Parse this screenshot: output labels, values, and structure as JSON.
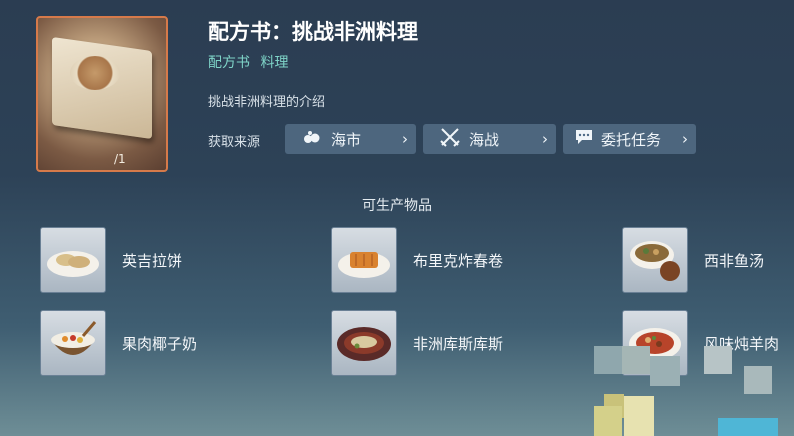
{
  "recipe": {
    "title": "配方书：挑战非洲料理",
    "tags": [
      "配方书",
      "料理"
    ],
    "description": "挑战非洲料理的介绍",
    "count": "/1"
  },
  "sources": {
    "label": "获取来源",
    "buttons": [
      {
        "label": "海市",
        "icon": "market-icon"
      },
      {
        "label": "海战",
        "icon": "crossed-swords-icon"
      },
      {
        "label": "委托任务",
        "icon": "chat-bubble-icon"
      }
    ]
  },
  "products": {
    "heading": "可生产物品",
    "items": [
      {
        "name": "英吉拉饼",
        "icon": "injera-dish-icon"
      },
      {
        "name": "布里克炸春卷",
        "icon": "brik-rolls-dish-icon"
      },
      {
        "name": "西非鱼汤",
        "icon": "fish-soup-dish-icon"
      },
      {
        "name": "果肉椰子奶",
        "icon": "coconut-milk-dish-icon"
      },
      {
        "name": "非洲库斯库斯",
        "icon": "couscous-dish-icon"
      },
      {
        "name": "风味炖羊肉",
        "icon": "lamb-stew-dish-icon"
      }
    ]
  },
  "colors": {
    "accent_tag": "#7fd4c8",
    "hero_border": "#d67a4a"
  }
}
